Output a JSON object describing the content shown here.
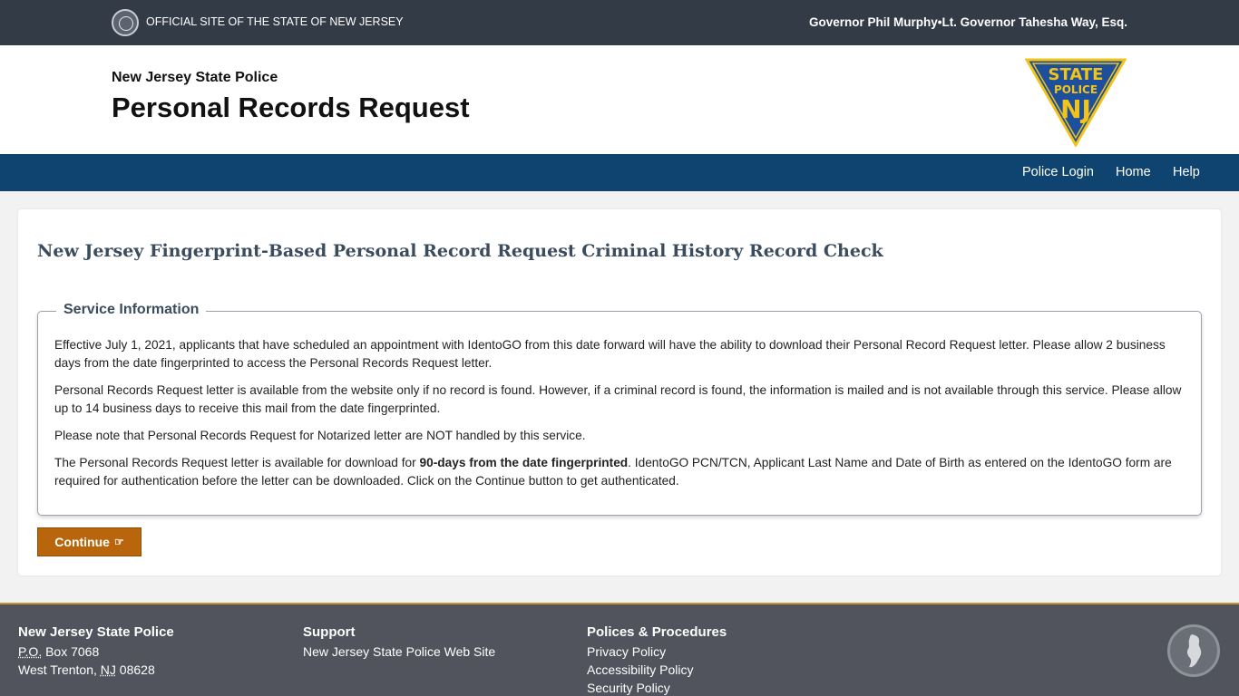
{
  "topbar": {
    "official_text": "OFFICIAL SITE OF THE STATE OF NEW JERSEY",
    "governor_text": "Governor Phil Murphy•Lt. Governor Tahesha Way, Esq."
  },
  "header": {
    "agency": "New Jersey State Police",
    "title": "Personal Records Request",
    "badge": {
      "line1": "STATE",
      "line2": "POLICE",
      "line3": "NJ"
    }
  },
  "nav": {
    "items": [
      "Police Login",
      "Home",
      "Help"
    ]
  },
  "main": {
    "heading": "New Jersey Fingerprint-Based Personal Record Request Criminal History Record Check",
    "service_info": {
      "legend": "Service Information",
      "p1": "Effective July 1, 2021, applicants that have scheduled an appointment with IdentoGO from this date forward will have the ability to download their Personal Record Request letter. Please allow 2 business days from the date fingerprinted to access the Personal Records Request letter.",
      "p2": "Personal Records Request letter is available from the website only if no record is found. However, if a criminal record is found, the information is mailed and is not available through this service. Please allow up to 14 business days to receive this mail from the date fingerprinted.",
      "p3": "Please note that Personal Records Request for Notarized letter are NOT handled by this service.",
      "p4_start": "The Personal Records Request letter is available for download for ",
      "p4_bold": "90-days from the date fingerprinted",
      "p4_end": ". IdentoGO PCN/TCN, Applicant Last Name and Date of Birth as entered on the IdentoGO form are required for authentication before the letter can be downloaded. Click on the Continue button to get authenticated."
    },
    "continue_label": "Continue",
    "continue_icon": "hand-pointing-right-icon"
  },
  "footer": {
    "col1": {
      "title": "New Jersey State Police",
      "po_abbr": "P.O.",
      "po_rest": " Box 7068",
      "city": "West Trenton, ",
      "state_abbr": "NJ",
      "zip": " 08628"
    },
    "col2": {
      "title": "Support",
      "link": "New Jersey State Police Web Site"
    },
    "col3": {
      "title": "Polices & Procedures",
      "links": [
        "Privacy Policy",
        "Accessibility Policy",
        "Security Policy"
      ]
    }
  },
  "colors": {
    "topbar": "#333b47",
    "nav": "#0f4470",
    "accent": "#b8650c",
    "footer": "#51545d",
    "badge_blue": "#1d4f9c",
    "badge_gold": "#f2c318"
  }
}
